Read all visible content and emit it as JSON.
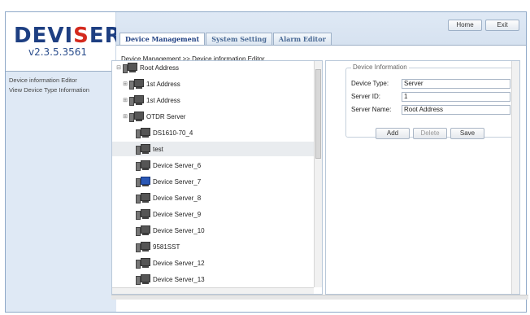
{
  "logo": {
    "brand_prefix": "DEVI",
    "brand_red": "S",
    "brand_suffix": "ER",
    "version": "v2.3.5.3561"
  },
  "header": {
    "home_label": "Home",
    "exit_label": "Exit"
  },
  "tabs": [
    {
      "label": "Device Management",
      "active": true
    },
    {
      "label": "System Setting",
      "active": false
    },
    {
      "label": "Alarm Editor",
      "active": false
    }
  ],
  "breadcrumb": "Device Management >> Device information Editor",
  "nav": {
    "items": [
      {
        "label": "Device information Editor"
      },
      {
        "label": "View Device Type Information"
      }
    ]
  },
  "tree": {
    "nodes": [
      {
        "label": "Root Address",
        "icon": "root-server-icon",
        "expander": "⊟"
      },
      {
        "label": "1st Address",
        "icon": "computer-icon",
        "expander": "⊞"
      },
      {
        "label": "1st Address",
        "icon": "computer-icon",
        "expander": "⊞"
      },
      {
        "label": "OTDR Server",
        "icon": "computer-icon",
        "expander": "⊞"
      },
      {
        "label": "DS1610-70_4",
        "icon": "computer-icon",
        "expander": ""
      },
      {
        "label": "test",
        "icon": "computer-icon",
        "expander": ""
      },
      {
        "label": "Device Server_6",
        "icon": "computer-icon",
        "expander": ""
      },
      {
        "label": "Device Server_7",
        "icon": "computer-blue-icon",
        "expander": ""
      },
      {
        "label": "Device Server_8",
        "icon": "computer-icon",
        "expander": ""
      },
      {
        "label": "Device Server_9",
        "icon": "computer-icon",
        "expander": ""
      },
      {
        "label": "Device Server_10",
        "icon": "computer-icon",
        "expander": ""
      },
      {
        "label": "9581SST",
        "icon": "computer-icon",
        "expander": ""
      },
      {
        "label": "Device Server_12",
        "icon": "computer-icon",
        "expander": ""
      },
      {
        "label": "Device Server_13",
        "icon": "computer-icon",
        "expander": ""
      }
    ]
  },
  "device_info": {
    "legend": "Device Information",
    "type_label": "Device Type:",
    "type_value": "Server",
    "id_label": "Server ID:",
    "id_value": "1",
    "name_label": "Server Name:",
    "name_value": "Root Address",
    "add_label": "Add",
    "delete_label": "Delete",
    "save_label": "Save"
  },
  "colors": {
    "brand_blue": "#1e3f82",
    "brand_red": "#d42a1e",
    "header_bg": "#dfe9f5",
    "selected_row": "#e9ecef"
  }
}
